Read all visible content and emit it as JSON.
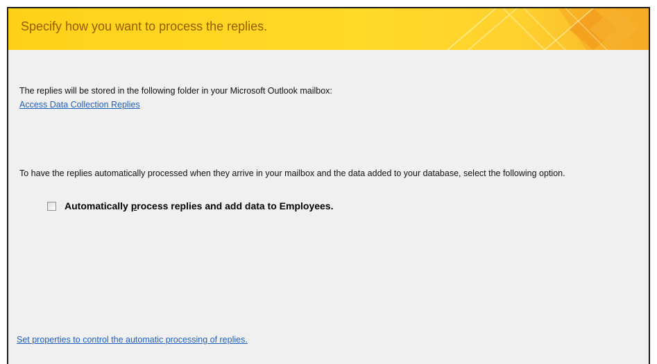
{
  "header": {
    "title": "Specify how you want to process the replies."
  },
  "storage": {
    "text": "The replies will be stored in the following folder in your Microsoft Outlook mailbox:",
    "folder_link": "Access Data Collection Replies"
  },
  "auto_process": {
    "text": "To have the replies automatically processed when they arrive in your mailbox and the data added to your database, select the following option.",
    "checkbox_label_pre": "Automatically ",
    "checkbox_label_access_key": "p",
    "checkbox_label_post": "rocess replies and add data to Employees.",
    "checked": false
  },
  "properties_link": "Set properties to control the automatic processing of replies.",
  "colors": {
    "header_background": "#ffd928",
    "header_title": "#9b5a00",
    "link": "#1f5fbf",
    "panel_background": "#f0f0f0"
  }
}
